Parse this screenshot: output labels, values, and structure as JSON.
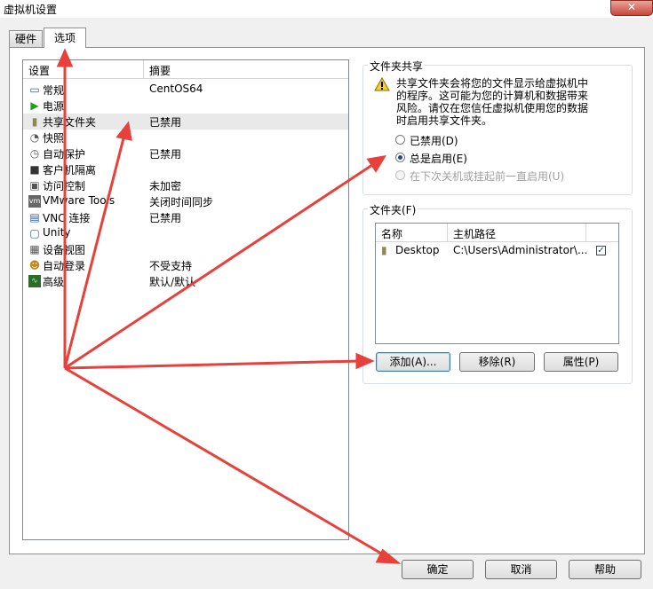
{
  "window": {
    "title": "虚拟机设置",
    "close_label": "✕"
  },
  "tabs": [
    {
      "label": "硬件"
    },
    {
      "label": "选项"
    }
  ],
  "settings_list": {
    "header": {
      "setting": "设置",
      "summary": "摘要"
    },
    "rows": [
      {
        "icon": "monitor-icon",
        "name": "常规",
        "summary": "CentOS64"
      },
      {
        "icon": "power-icon",
        "name": "电源",
        "summary": ""
      },
      {
        "icon": "shared-folder-icon",
        "name": "共享文件夹",
        "summary": "已禁用"
      },
      {
        "icon": "snapshot-icon",
        "name": "快照",
        "summary": ""
      },
      {
        "icon": "autoprotect-icon",
        "name": "自动保护",
        "summary": "已禁用"
      },
      {
        "icon": "guest-isolation-icon",
        "name": "客户机隔离",
        "summary": ""
      },
      {
        "icon": "access-control-icon",
        "name": "访问控制",
        "summary": "未加密"
      },
      {
        "icon": "vmware-tools-icon",
        "name": "VMware Tools",
        "summary": "关闭时间同步"
      },
      {
        "icon": "vnc-icon",
        "name": "VNC 连接",
        "summary": "已禁用"
      },
      {
        "icon": "unity-icon",
        "name": "Unity",
        "summary": ""
      },
      {
        "icon": "device-view-icon",
        "name": "设备视图",
        "summary": ""
      },
      {
        "icon": "autologin-icon",
        "name": "自动登录",
        "summary": "不受支持"
      },
      {
        "icon": "advanced-icon",
        "name": "高级",
        "summary": "默认/默认"
      }
    ]
  },
  "folder_sharing": {
    "title": "文件夹共享",
    "warning_line1": "共享文件夹会将您的文件显示给虚拟机中",
    "warning_line2": "的程序。这可能为您的计算机和数据带来",
    "warning_line3": "风险。请仅在您信任虚拟机使用您的数据",
    "warning_line4": "时启用共享文件夹。",
    "options": [
      {
        "label": "已禁用(D)",
        "checked": false,
        "enabled": true
      },
      {
        "label": "总是启用(E)",
        "checked": true,
        "enabled": true
      },
      {
        "label": "在下次关机或挂起前一直启用(U)",
        "checked": false,
        "enabled": false
      }
    ]
  },
  "folders": {
    "title": "文件夹(F)",
    "columns": {
      "name": "名称",
      "host_path": "主机路径"
    },
    "items": [
      {
        "name": "Desktop",
        "host_path": "C:\\Users\\Administrator\\...",
        "enabled": true
      }
    ],
    "add_label": "添加(A)...",
    "remove_label": "移除(R)",
    "properties_label": "属性(P)"
  },
  "footer": {
    "ok_label": "确定",
    "cancel_label": "取消",
    "help_label": "帮助"
  },
  "annotation": {
    "arrow_color": "#e8403a"
  },
  "colors": {
    "selected_row": "#e9e9e9",
    "accent": "#3c7fb1"
  }
}
